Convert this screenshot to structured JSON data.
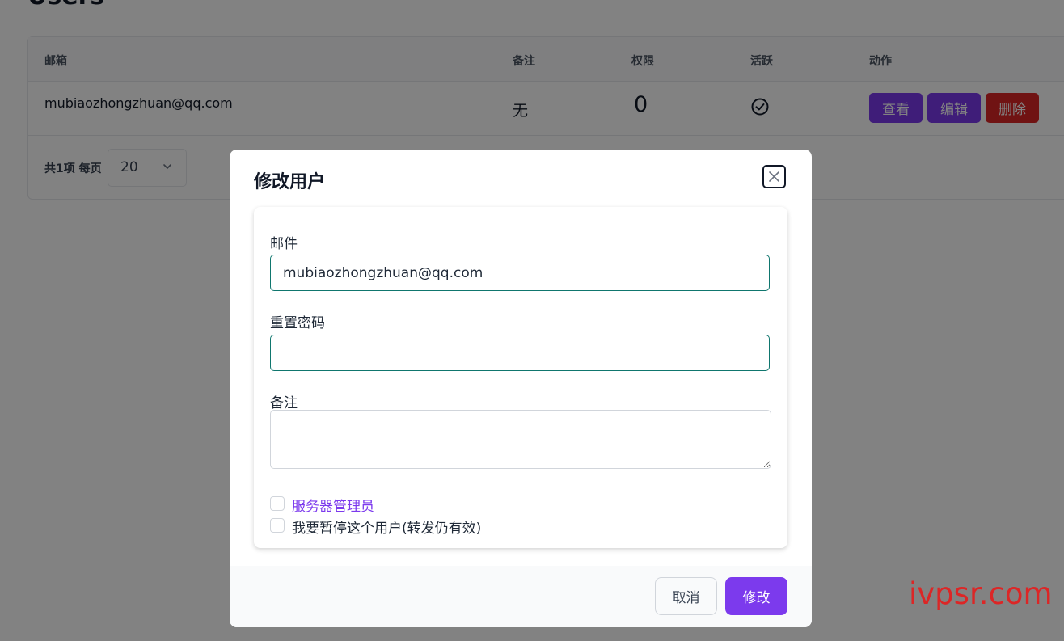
{
  "page": {
    "title": "Users"
  },
  "table": {
    "columns": [
      "邮箱",
      "备注",
      "权限",
      "活跃",
      "动作"
    ],
    "rows": [
      {
        "email": "mubiaozhongzhuan@qq.com",
        "note": "无",
        "permission": "0",
        "active_icon": "check-circle-icon",
        "actions": [
          "查看",
          "编辑",
          "删除"
        ]
      }
    ]
  },
  "pagination": {
    "summary": "共1项 每页",
    "page_size": "20"
  },
  "modal": {
    "title": "修改用户",
    "fields": {
      "email_label": "邮件",
      "email_value": "mubiaozhongzhuan@qq.com",
      "password_label": "重置密码",
      "password_value": "",
      "note_label": "备注",
      "note_value": ""
    },
    "checkboxes": {
      "admin_label": "服务器管理员",
      "suspend_label": "我要暂停这个用户(转发仍有效)"
    },
    "buttons": {
      "cancel": "取消",
      "submit": "修改"
    }
  },
  "watermark": "ivpsr.com",
  "colors": {
    "primary": "#7c3aed",
    "danger": "#dc2626",
    "input_border": "#0f766e"
  }
}
